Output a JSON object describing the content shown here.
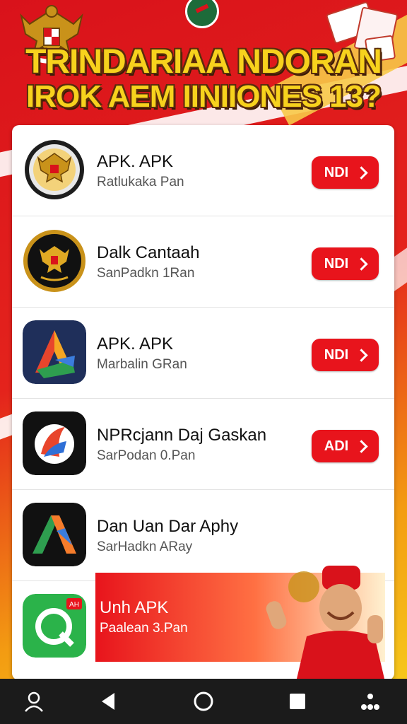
{
  "header": {
    "title_line1": "TRINDARIAA NDORAN",
    "title_line2": "IROK  AEM IINIIONES 13?"
  },
  "apps": [
    {
      "name": "APK. APK",
      "subtitle": "Ratlukaka Pan",
      "button": "NDI",
      "icon": "garuda-emblem-icon"
    },
    {
      "name": "Dalk Cantaah",
      "subtitle": "SanPadkn 1Ran",
      "button": "NDI",
      "icon": "garuda-seal-icon"
    },
    {
      "name": "APK. APK",
      "subtitle": "Marbalin GRan",
      "button": "NDI",
      "icon": "colorful-a-logo-icon"
    },
    {
      "name": "NPRcjann Daj Gaskan",
      "subtitle": "SarPodan 0.Pan",
      "button": "ADI",
      "icon": "stylized-a-logo-icon"
    },
    {
      "name": "Dan Uan Dar Aphy",
      "subtitle": "SarHadkn ARay",
      "icon": "gradient-chevron-logo-icon"
    }
  ],
  "promo": {
    "title": "Unh APK",
    "subtitle": "Paalean 3.Pan",
    "icon": "green-q-app-icon",
    "badge": "AH"
  },
  "navbar": {
    "icons": [
      "user-icon",
      "back-icon",
      "home-icon",
      "recents-icon",
      "more-icon"
    ]
  },
  "colors": {
    "accent": "#e8141c",
    "gold": "#f7d21d",
    "navbar": "#1b1b1b"
  }
}
